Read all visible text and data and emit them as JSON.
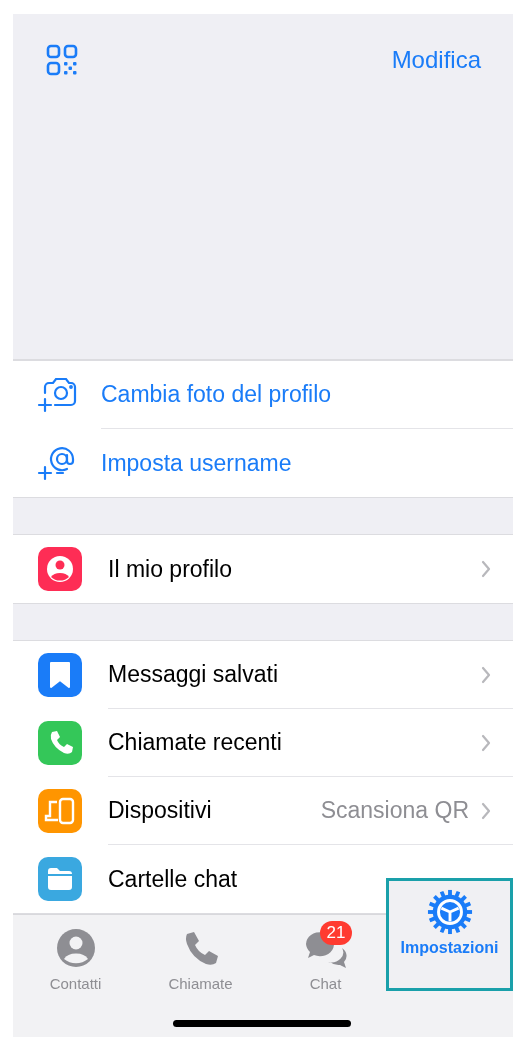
{
  "header": {
    "edit_label": "Modifica"
  },
  "actions": [
    {
      "kind": "camera",
      "label": "Cambia foto del profilo"
    },
    {
      "kind": "username",
      "label": "Imposta username"
    }
  ],
  "sections": [
    [
      {
        "kind": "profile",
        "color": "#fe2d55",
        "label": "Il mio profilo",
        "chevron": true
      }
    ],
    [
      {
        "kind": "saved",
        "color": "#1a7cf8",
        "label": "Messaggi salvati",
        "chevron": true
      },
      {
        "kind": "calls",
        "color": "#34c759",
        "label": "Chiamate recenti",
        "chevron": true
      },
      {
        "kind": "devices",
        "color": "#ff9500",
        "label": "Dispositivi",
        "value": "Scansiona QR",
        "chevron": true
      },
      {
        "kind": "folders",
        "color": "#3aa8e0",
        "label": "Cartelle chat",
        "chevron": false
      }
    ]
  ],
  "tabs": [
    {
      "kind": "contacts",
      "label": "Contatti",
      "selected": false,
      "highlighted": false
    },
    {
      "kind": "calls",
      "label": "Chiamate",
      "selected": false,
      "highlighted": false
    },
    {
      "kind": "chats",
      "label": "Chat",
      "selected": false,
      "highlighted": false,
      "badge": "21"
    },
    {
      "kind": "settings",
      "label": "Impostazioni",
      "selected": true,
      "highlighted": true
    }
  ]
}
